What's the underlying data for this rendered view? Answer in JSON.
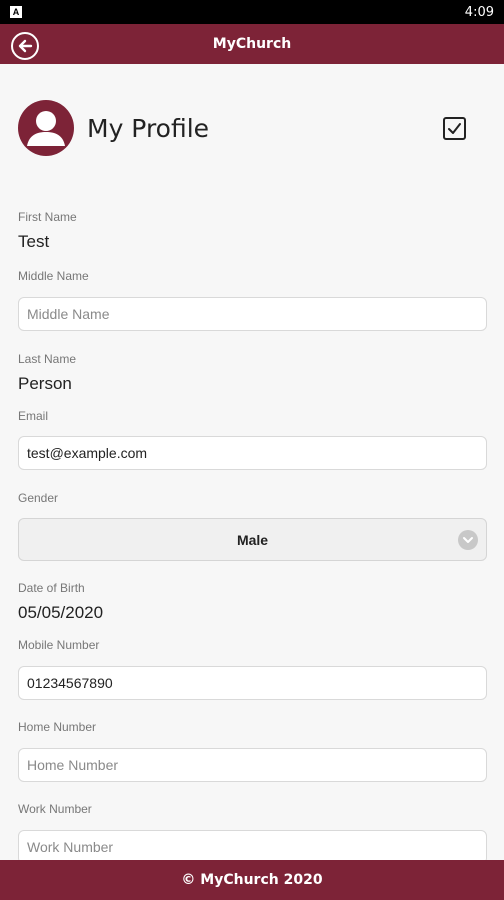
{
  "status_bar": {
    "time": "4:09",
    "notification_icon": "A"
  },
  "app_bar": {
    "title": "MyChurch",
    "back_icon": "back-arrow-icon"
  },
  "header": {
    "title": "My Profile",
    "avatar_icon": "user-avatar-icon",
    "save_icon": "checkbox-check-icon"
  },
  "form": {
    "first_name": {
      "label": "First Name",
      "value": "Test"
    },
    "middle_name": {
      "label": "Middle Name",
      "value": "",
      "placeholder": "Middle Name"
    },
    "last_name": {
      "label": "Last Name",
      "value": "Person"
    },
    "email": {
      "label": "Email",
      "value": "test@example.com",
      "placeholder": ""
    },
    "gender": {
      "label": "Gender",
      "value": "Male"
    },
    "date_of_birth": {
      "label": "Date of Birth",
      "value": "05/05/2020"
    },
    "mobile_number": {
      "label": "Mobile Number",
      "value": "01234567890",
      "placeholder": ""
    },
    "home_number": {
      "label": "Home Number",
      "value": "",
      "placeholder": "Home Number"
    },
    "work_number": {
      "label": "Work Number",
      "value": "",
      "placeholder": "Work Number"
    }
  },
  "footer": {
    "text": "© MyChurch 2020"
  },
  "colors": {
    "brand": "#7d2337",
    "background": "#f7f7f7"
  }
}
